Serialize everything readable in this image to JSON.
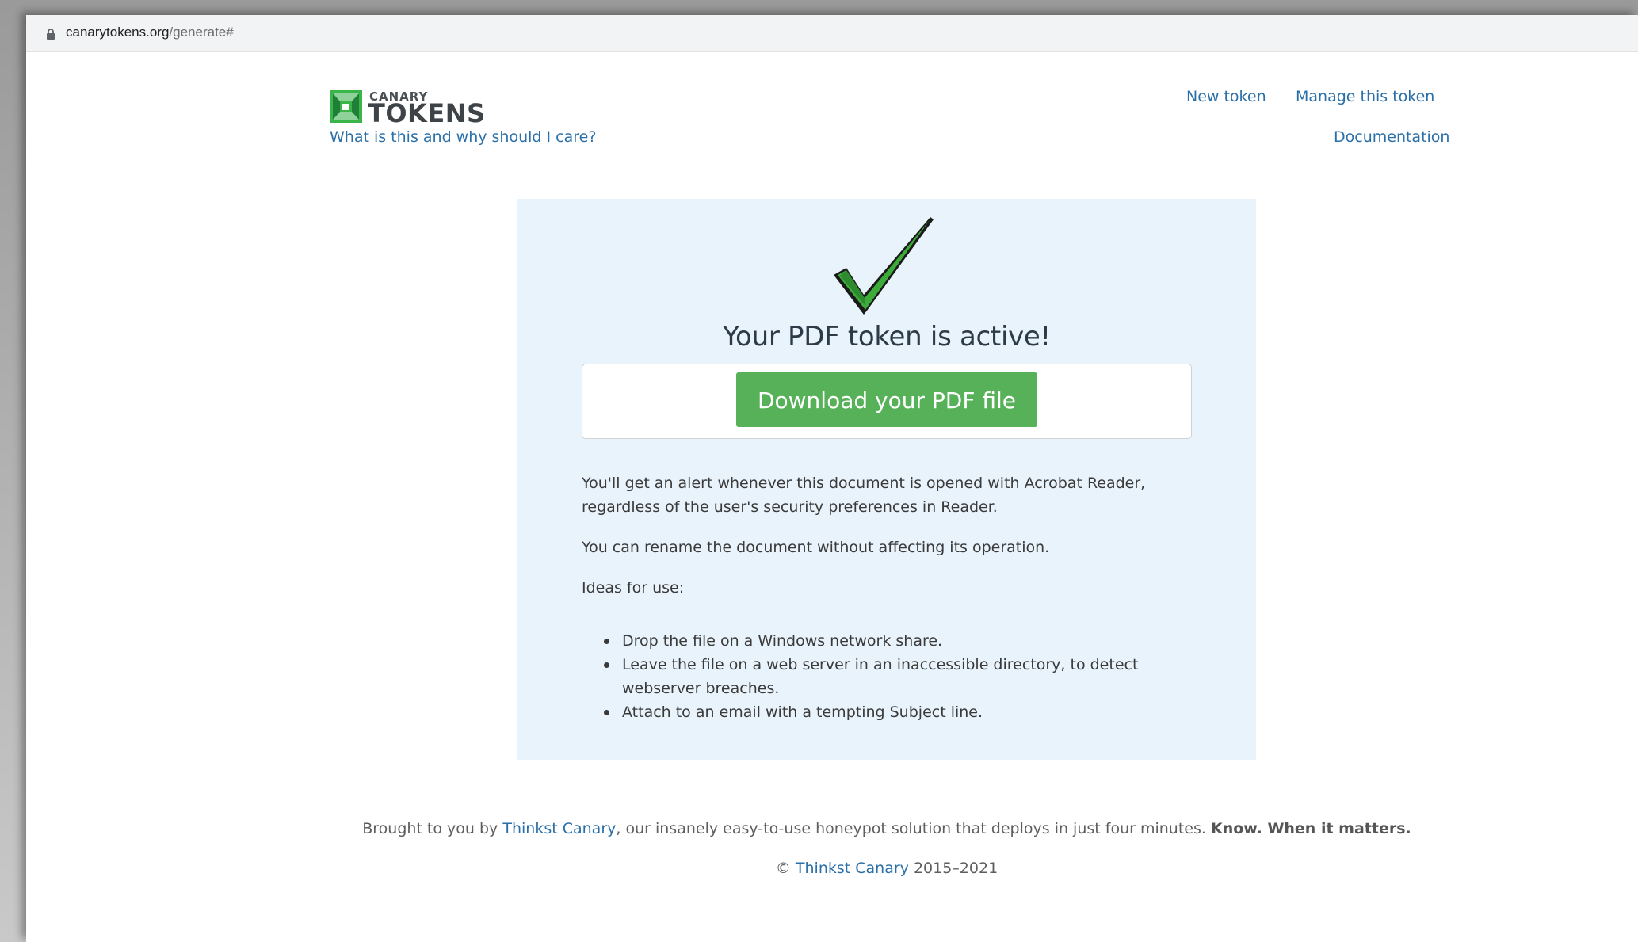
{
  "browser": {
    "url_domain": "canarytokens.org",
    "url_path": "/generate#"
  },
  "header": {
    "logo_top": "CANARY",
    "logo_bottom": "TOKENS",
    "about_link": "What is this and why should I care?",
    "nav": {
      "new_token": "New token",
      "manage_token": "Manage this token",
      "documentation": "Documentation"
    }
  },
  "result": {
    "title": "Your PDF token is active!",
    "download_button": "Download your PDF file",
    "alert_text": "You'll get an alert whenever this document is opened with Acrobat Reader, regardless of the user's security preferences in Reader.",
    "rename_text": "You can rename the document without affecting its operation.",
    "ideas_heading": "Ideas for use:",
    "ideas": [
      "Drop the file on a Windows network share.",
      "Leave the file on a web server in an inaccessible directory, to detect webserver breaches.",
      "Attach to an email with a tempting Subject line."
    ]
  },
  "footer": {
    "prefix": "Brought to you by ",
    "brand_link": "Thinkst Canary",
    "middle": ", our insanely easy-to-use honeypot solution that deploys in just four minutes. ",
    "tagline": "Know. When it matters.",
    "copyright_symbol": "© ",
    "copyright_link": "Thinkst Canary",
    "copyright_years": " 2015–2021"
  },
  "colors": {
    "link": "#2a6fa8",
    "button_green": "#56b158",
    "card_background": "#e9f3fb",
    "logo_green": "#3ab54a"
  },
  "icons": {
    "lock": "lock-icon",
    "check": "checkmark-icon",
    "logo": "canary-logo-icon"
  }
}
